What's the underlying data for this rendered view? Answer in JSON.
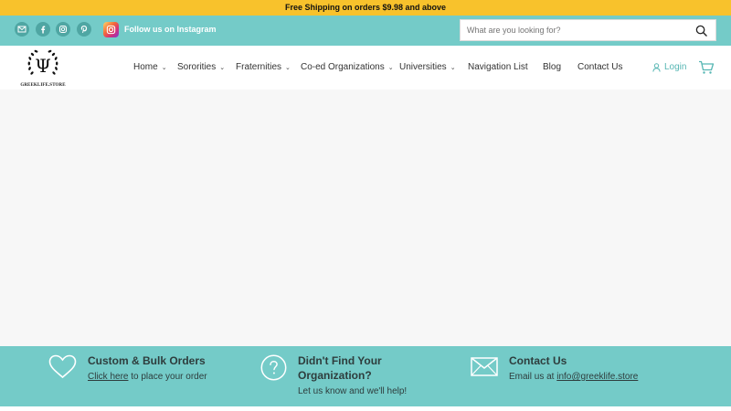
{
  "announcement": "Free Shipping on orders $9.98 and above",
  "social": {
    "icons": [
      "email-icon",
      "facebook-icon",
      "instagram-icon",
      "pinterest-icon"
    ],
    "instagram_cta": "Follow us on Instagram"
  },
  "search": {
    "placeholder": "What are you looking for?"
  },
  "logo": {
    "symbol": "Ψ",
    "wordmark": "GREEKLIFE.STORE"
  },
  "nav": {
    "items": [
      {
        "label": "Home",
        "dropdown": true
      },
      {
        "label": "Sororities",
        "dropdown": true
      },
      {
        "label": "Fraternities",
        "dropdown": true
      },
      {
        "label": "Co-ed Organizations",
        "dropdown": true
      },
      {
        "label": "Universities",
        "dropdown": true
      },
      {
        "label": "Navigation List",
        "dropdown": false
      },
      {
        "label": "Blog",
        "dropdown": false
      },
      {
        "label": "Contact Us",
        "dropdown": false
      }
    ],
    "login": "Login"
  },
  "footer_band": {
    "bulk": {
      "title": "Custom & Bulk Orders",
      "link": "Click here",
      "text": " to place your order"
    },
    "org": {
      "title_line1": "Didn't Find Your",
      "title_line2": "Organization?",
      "text": "Let us know and we'll help!"
    },
    "contact": {
      "title": "Contact Us",
      "text": "Email us at ",
      "email": "info@greeklife.store"
    }
  },
  "colors": {
    "announcement_bg": "#f8c22c",
    "teal": "#74cbc8",
    "accent_text": "#56b6b3"
  }
}
